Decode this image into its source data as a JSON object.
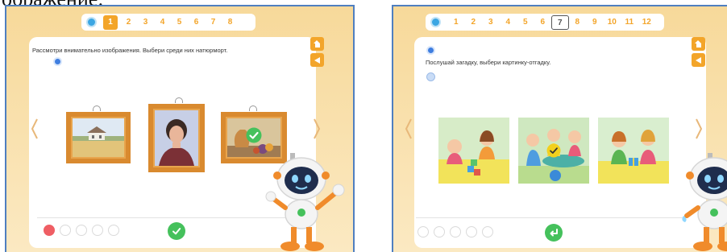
{
  "caption": {
    "text": "ображение:"
  },
  "screen1": {
    "pagination": {
      "pages": [
        "1",
        "2",
        "3",
        "4",
        "5",
        "6",
        "7",
        "8"
      ],
      "active": "1"
    },
    "instruction": "Рассмотри внимательно изображения. Выбери среди них натюрморт.",
    "pictures": [
      {
        "subject": "landscape"
      },
      {
        "subject": "portrait"
      },
      {
        "subject": "still-life",
        "selected": true
      }
    ],
    "progress": {
      "total": 5,
      "done": 1
    },
    "action_button": "check"
  },
  "screen2": {
    "pagination": {
      "pages": [
        "1",
        "2",
        "3",
        "4",
        "5",
        "6",
        "7",
        "8",
        "9",
        "10",
        "11",
        "12"
      ],
      "active": "7"
    },
    "instruction": "Послушай загадку, выбери картинку-отгадку.",
    "pictures": [
      {
        "subject": "children-playing-blocks"
      },
      {
        "subject": "children-at-table",
        "selected": true
      },
      {
        "subject": "children-with-gift"
      }
    ],
    "progress": {
      "total": 5,
      "done": 0
    },
    "action_button": "enter"
  },
  "colors": {
    "panel_bg": "#f9e2ad",
    "panel_border": "#4f7fc0",
    "accent_orange": "#f3a52a",
    "check_green": "#45c15c",
    "progress_red": "#ef5e64",
    "frame_gold": "#d98a2f"
  }
}
